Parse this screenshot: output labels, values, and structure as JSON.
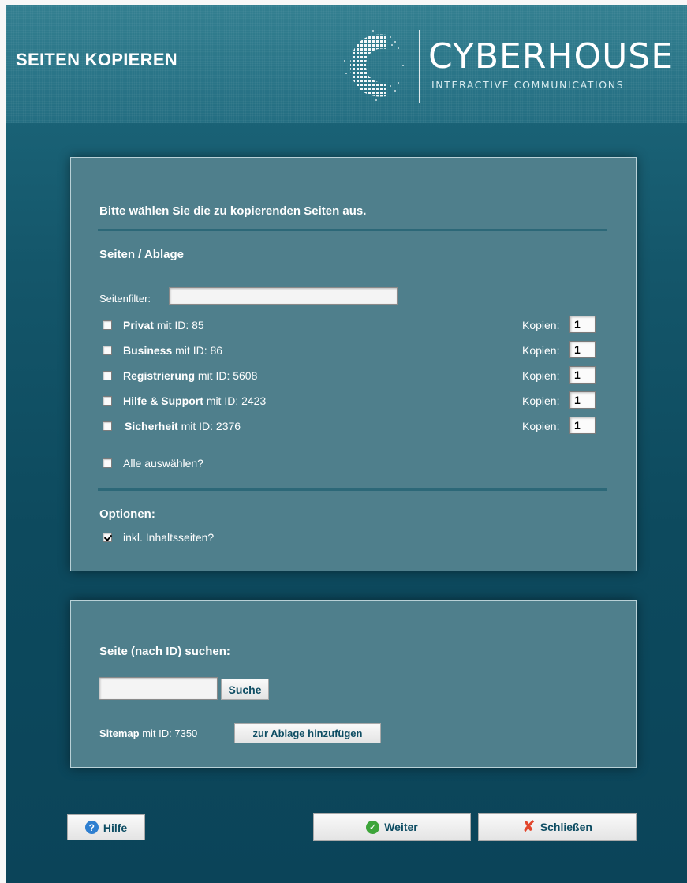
{
  "header": {
    "title": "SEITEN KOPIEREN",
    "logo_name": "CYBERHOUSE",
    "logo_tagline": "INTERACTIVE COMMUNICATIONS"
  },
  "copy_panel": {
    "instruction": "Bitte wählen Sie die zu kopierenden Seiten aus.",
    "section_title": "Seiten / Ablage",
    "filter_label": "Seitenfilter:",
    "filter_value": "",
    "kopien_label": "Kopien:",
    "pages": [
      {
        "name": "Privat",
        "id_text": "mit ID: 85",
        "checked": false,
        "copies": "1"
      },
      {
        "name": "Business",
        "id_text": "mit ID: 86",
        "checked": false,
        "copies": "1"
      },
      {
        "name": "Registrierung",
        "id_text": "mit ID: 5608",
        "checked": false,
        "copies": "1"
      },
      {
        "name": "Hilfe & Support",
        "id_text": "mit ID: 2423",
        "checked": false,
        "copies": "1"
      },
      {
        "name": "Sicherheit",
        "id_text": "mit ID: 2376",
        "checked": false,
        "copies": "1"
      }
    ],
    "select_all_label": "Alle auswählen?",
    "select_all_checked": false,
    "options_title": "Optionen:",
    "include_content_label": "inkl. Inhaltsseiten?",
    "include_content_checked": true
  },
  "search_panel": {
    "title": "Seite (nach ID) suchen:",
    "search_value": "",
    "search_button": "Suche",
    "result_name": "Sitemap",
    "result_id_text": "mit ID: 7350",
    "add_button": "zur Ablage hinzufügen"
  },
  "footer": {
    "help_button": "Hilfe",
    "next_button": "Weiter",
    "close_button": "Schließen"
  },
  "colors": {
    "background": "#0d4a5e",
    "panel": "#4f7f8c",
    "button_text": "#0e4d63"
  }
}
